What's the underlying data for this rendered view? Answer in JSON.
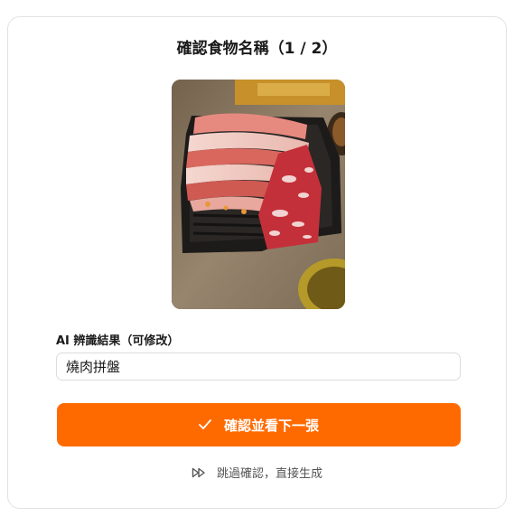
{
  "dialog": {
    "title": "確認食物名稱（1 / 2）"
  },
  "photo": {
    "alt": "燒肉拼盤"
  },
  "form": {
    "label": "AI 辨識結果（可修改）",
    "value": "燒肉拼盤"
  },
  "actions": {
    "confirm_label": "確認並看下一張",
    "skip_label": "跳過確認，直接生成"
  },
  "colors": {
    "accent": "#ff6a00"
  },
  "icons": {
    "confirm": "check-icon",
    "skip": "fast-forward-icon"
  }
}
